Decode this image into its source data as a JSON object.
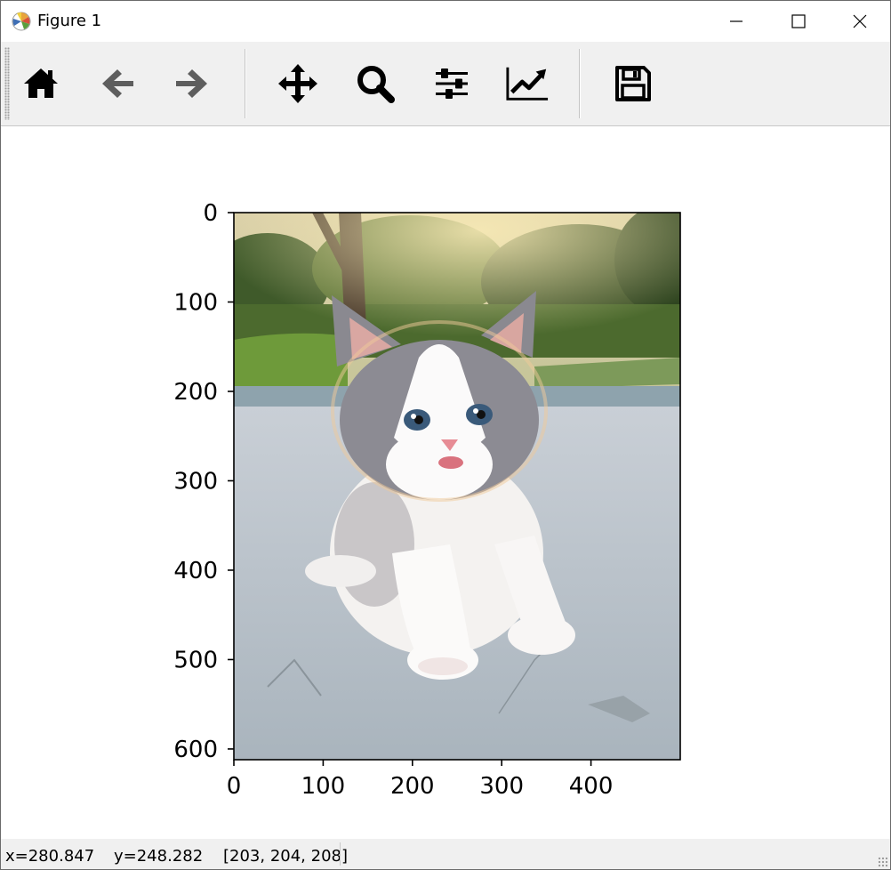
{
  "window": {
    "title": "Figure 1",
    "controls": {
      "minimize": "minimize-icon",
      "maximize": "maximize-icon",
      "close": "close-icon"
    }
  },
  "toolbar": {
    "buttons": [
      {
        "icon": "home-icon",
        "tooltip": "Reset original view"
      },
      {
        "icon": "back-arrow-icon",
        "tooltip": "Back to previous view"
      },
      {
        "icon": "forward-arrow-icon",
        "tooltip": "Forward to next view"
      },
      {
        "icon": "pan-move-icon",
        "tooltip": "Pan axes"
      },
      {
        "icon": "zoom-magnifier-icon",
        "tooltip": "Zoom to rectangle"
      },
      {
        "icon": "subplots-sliders-icon",
        "tooltip": "Configure subplots"
      },
      {
        "icon": "edit-axis-chart-icon",
        "tooltip": "Edit axis, curve and image parameters"
      },
      {
        "icon": "save-floppy-icon",
        "tooltip": "Save the figure"
      }
    ]
  },
  "plot": {
    "image_subject": "kitten photo",
    "x_ticks": [
      "0",
      "100",
      "200",
      "300",
      "400"
    ],
    "y_ticks": [
      "0",
      "100",
      "200",
      "300",
      "400",
      "500",
      "600"
    ],
    "x_range": [
      0,
      500
    ],
    "y_range": [
      0,
      612
    ]
  },
  "statusbar": {
    "x": "x=280.847",
    "y": "y=248.282",
    "pixel": "[203, 204, 208]"
  }
}
